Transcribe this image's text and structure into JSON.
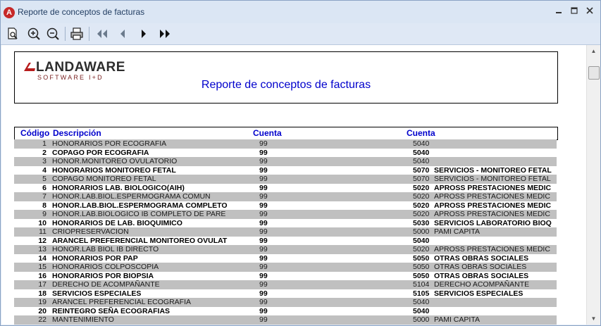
{
  "window": {
    "title": "Reporte de conceptos de facturas"
  },
  "toolbar": {
    "buttons": [
      {
        "name": "print-preview",
        "icon": "page-zoom-icon"
      },
      {
        "name": "zoom-in",
        "icon": "zoom-in-icon"
      },
      {
        "name": "zoom-out",
        "icon": "zoom-out-icon"
      },
      {
        "name": "print",
        "icon": "printer-icon"
      },
      {
        "name": "first-page",
        "icon": "first-page-icon"
      },
      {
        "name": "previous-page",
        "icon": "previous-page-icon"
      },
      {
        "name": "next-page",
        "icon": "next-page-icon"
      },
      {
        "name": "last-page",
        "icon": "last-page-icon"
      }
    ]
  },
  "report": {
    "logo": {
      "main": "LANDAWARE",
      "sub": "SOFTWARE I+D"
    },
    "title": "Reporte de conceptos de facturas",
    "headers": {
      "code": "Código",
      "desc": "Descripción",
      "cuenta1": "Cuenta",
      "cuenta2": "Cuenta"
    },
    "rows": [
      {
        "code": "1",
        "desc": "HONORARIOS POR ECOGRAFIA",
        "cuenta1": "99",
        "cuenta2": "5040",
        "cuenta2_name": "",
        "bold": false
      },
      {
        "code": "2",
        "desc": "COPAGO POR ECOGRAFIA",
        "cuenta1": "99",
        "cuenta2": "5040",
        "cuenta2_name": "",
        "bold": true
      },
      {
        "code": "3",
        "desc": "HONOR.MONITOREO OVULATORIO",
        "cuenta1": "99",
        "cuenta2": "5040",
        "cuenta2_name": "",
        "bold": false
      },
      {
        "code": "4",
        "desc": "HONORARIOS MONITOREO FETAL",
        "cuenta1": "99",
        "cuenta2": "5070",
        "cuenta2_name": "SERVICIOS - MONITOREO FETAL",
        "bold": true
      },
      {
        "code": "5",
        "desc": "COPAGO MONITOREO FETAL",
        "cuenta1": "99",
        "cuenta2": "5070",
        "cuenta2_name": "SERVICIOS - MONITOREO FETAL",
        "bold": false
      },
      {
        "code": "6",
        "desc": "HONORARIOS LAB. BIOLOGICO(AIH)",
        "cuenta1": "99",
        "cuenta2": "5020",
        "cuenta2_name": "APROSS PRESTACIONES MEDIC",
        "bold": true
      },
      {
        "code": "7",
        "desc": "HONOR.LAB.BIOL.ESPERMOGRAMA COMUN",
        "cuenta1": "99",
        "cuenta2": "5020",
        "cuenta2_name": "APROSS PRESTACIONES MEDIC",
        "bold": false
      },
      {
        "code": "8",
        "desc": "HONOR.LAB.BIOL.ESPERMOGRAMA COMPLETO",
        "cuenta1": "99",
        "cuenta2": "5020",
        "cuenta2_name": "APROSS PRESTACIONES MEDIC",
        "bold": true
      },
      {
        "code": "9",
        "desc": "HONOR.LAB.BIOLOGICO IB COMPLETO DE PARE",
        "cuenta1": "99",
        "cuenta2": "5020",
        "cuenta2_name": "APROSS PRESTACIONES MEDIC",
        "bold": false
      },
      {
        "code": "10",
        "desc": "HONORARIOS DE LAB. BIOQUIMICO",
        "cuenta1": "99",
        "cuenta2": "5030",
        "cuenta2_name": "SERVICIOS LABORATORIO BIOQ",
        "bold": true
      },
      {
        "code": "11",
        "desc": "CRIOPRESERVACION",
        "cuenta1": "99",
        "cuenta2": "5000",
        "cuenta2_name": "PAMI CAPITA",
        "bold": false
      },
      {
        "code": "12",
        "desc": "ARANCEL PREFERENCIAL  MONITOREO OVULAT",
        "cuenta1": "99",
        "cuenta2": "5040",
        "cuenta2_name": "",
        "bold": true
      },
      {
        "code": "13",
        "desc": "HONOR.LAB BIOL IB DIRECTO",
        "cuenta1": "99",
        "cuenta2": "5020",
        "cuenta2_name": "APROSS PRESTACIONES MEDIC",
        "bold": false
      },
      {
        "code": "14",
        "desc": "HONORARIOS POR PAP",
        "cuenta1": "99",
        "cuenta2": "5050",
        "cuenta2_name": "OTRAS OBRAS SOCIALES",
        "bold": true
      },
      {
        "code": "15",
        "desc": "HONORARIOS COLPOSCOPIA",
        "cuenta1": "99",
        "cuenta2": "5050",
        "cuenta2_name": "OTRAS OBRAS SOCIALES",
        "bold": false
      },
      {
        "code": "16",
        "desc": "HONORARIOS POR BIOPSIA",
        "cuenta1": "99",
        "cuenta2": "5050",
        "cuenta2_name": "OTRAS OBRAS SOCIALES",
        "bold": true
      },
      {
        "code": "17",
        "desc": "DERECHO DE ACOMPAÑANTE",
        "cuenta1": "99",
        "cuenta2": "5104",
        "cuenta2_name": "DERECHO ACOMPAÑANTE",
        "bold": false
      },
      {
        "code": "18",
        "desc": "SERVICIOS ESPECIALES",
        "cuenta1": "99",
        "cuenta2": "5105",
        "cuenta2_name": "SERVICIOS ESPECIALES",
        "bold": true
      },
      {
        "code": "19",
        "desc": "ARANCEL PREFERENCIAL ECOGRAFIA",
        "cuenta1": "99",
        "cuenta2": "5040",
        "cuenta2_name": "",
        "bold": false
      },
      {
        "code": "20",
        "desc": "REINTEGRO SEÑA ECOGRAFIAS",
        "cuenta1": "99",
        "cuenta2": "5040",
        "cuenta2_name": "",
        "bold": true
      },
      {
        "code": "22",
        "desc": "MANTENIMIENTO",
        "cuenta1": "99",
        "cuenta2": "5000",
        "cuenta2_name": "PAMI CAPITA",
        "bold": false
      }
    ]
  }
}
